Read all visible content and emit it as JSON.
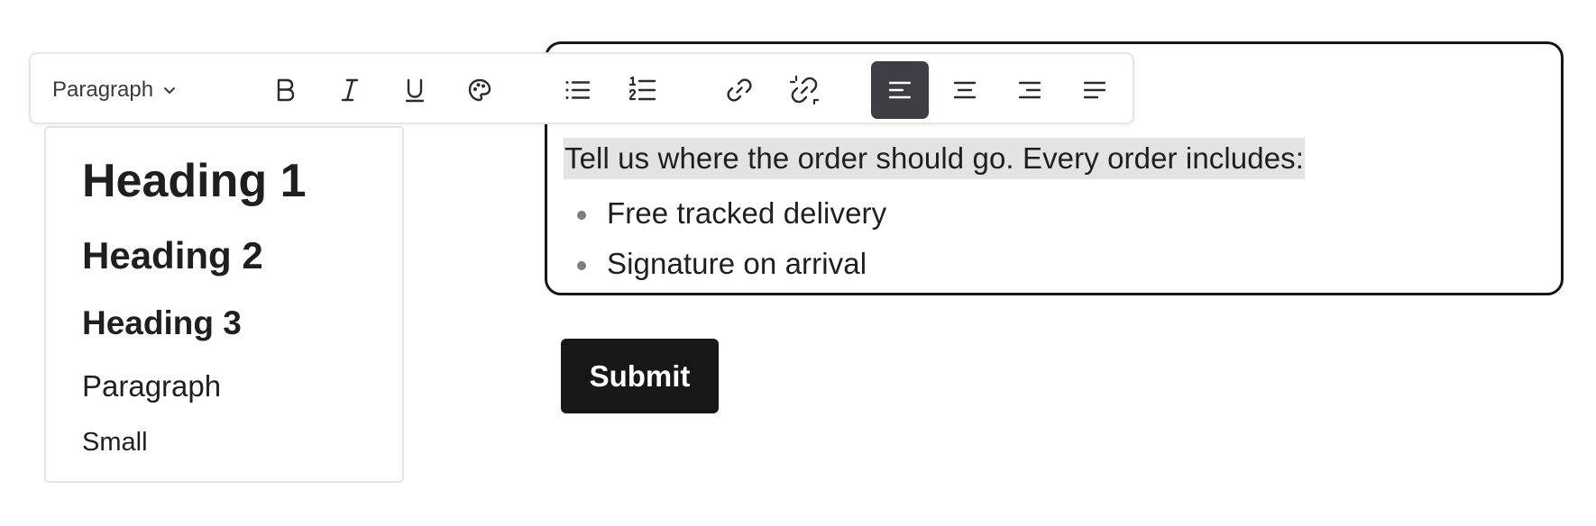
{
  "toolbar": {
    "format_label": "Paragraph",
    "buttons": [
      {
        "id": "bold",
        "icon": "bold-icon"
      },
      {
        "id": "italic",
        "icon": "italic-icon"
      },
      {
        "id": "underline",
        "icon": "underline-icon"
      },
      {
        "id": "color",
        "icon": "palette-icon"
      },
      {
        "id": "bulleted_list",
        "icon": "bulleted-list-icon"
      },
      {
        "id": "numbered_list",
        "icon": "numbered-list-icon"
      },
      {
        "id": "link",
        "icon": "link-icon"
      },
      {
        "id": "unlink",
        "icon": "unlink-icon"
      },
      {
        "id": "align_left",
        "icon": "align-left-icon",
        "active": true
      },
      {
        "id": "align_center",
        "icon": "align-center-icon"
      },
      {
        "id": "align_right",
        "icon": "align-right-icon"
      },
      {
        "id": "align_justify",
        "icon": "align-justify-icon"
      }
    ]
  },
  "format_menu": {
    "options": [
      "Heading 1",
      "Heading 2",
      "Heading 3",
      "Paragraph",
      "Small"
    ]
  },
  "editor": {
    "paragraph": "Tell us where the order should go. Every order includes:",
    "list_items": [
      "Free tracked delivery",
      "Signature on arrival"
    ]
  },
  "submit": {
    "label": "Submit"
  },
  "colors": {
    "editor_border": "#161616",
    "highlight": "#e3e3e3",
    "active_button": "#3d3f45",
    "submit_background": "#171717"
  }
}
